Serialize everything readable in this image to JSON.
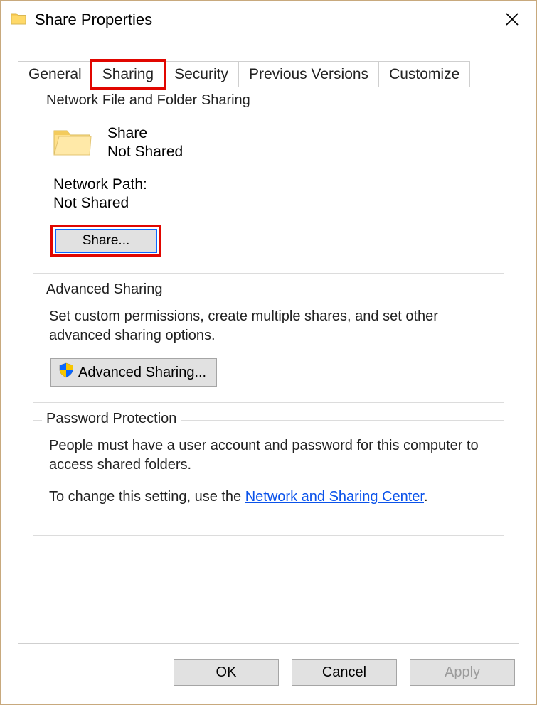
{
  "window": {
    "title": "Share Properties"
  },
  "tabs": {
    "general": {
      "label": "General"
    },
    "sharing": {
      "label": "Sharing"
    },
    "security": {
      "label": "Security"
    },
    "prev": {
      "label": "Previous Versions"
    },
    "custom": {
      "label": "Customize"
    },
    "active": "sharing",
    "highlighted": "sharing"
  },
  "group_network": {
    "legend": "Network File and Folder Sharing",
    "item_name": "Share",
    "item_status": "Not Shared",
    "network_path_label": "Network Path:",
    "network_path_value": "Not Shared",
    "share_button": "Share...",
    "share_button_highlighted": true
  },
  "group_advanced": {
    "legend": "Advanced Sharing",
    "description": "Set custom permissions, create multiple shares, and set other advanced sharing options.",
    "button": "Advanced Sharing..."
  },
  "group_password": {
    "legend": "Password Protection",
    "line1": "People must have a user account and password for this computer to access shared folders.",
    "line2_pre": "To change this setting, use the ",
    "link": "Network and Sharing Center",
    "line2_post": "."
  },
  "footer": {
    "ok": "OK",
    "cancel": "Cancel",
    "apply": "Apply"
  }
}
